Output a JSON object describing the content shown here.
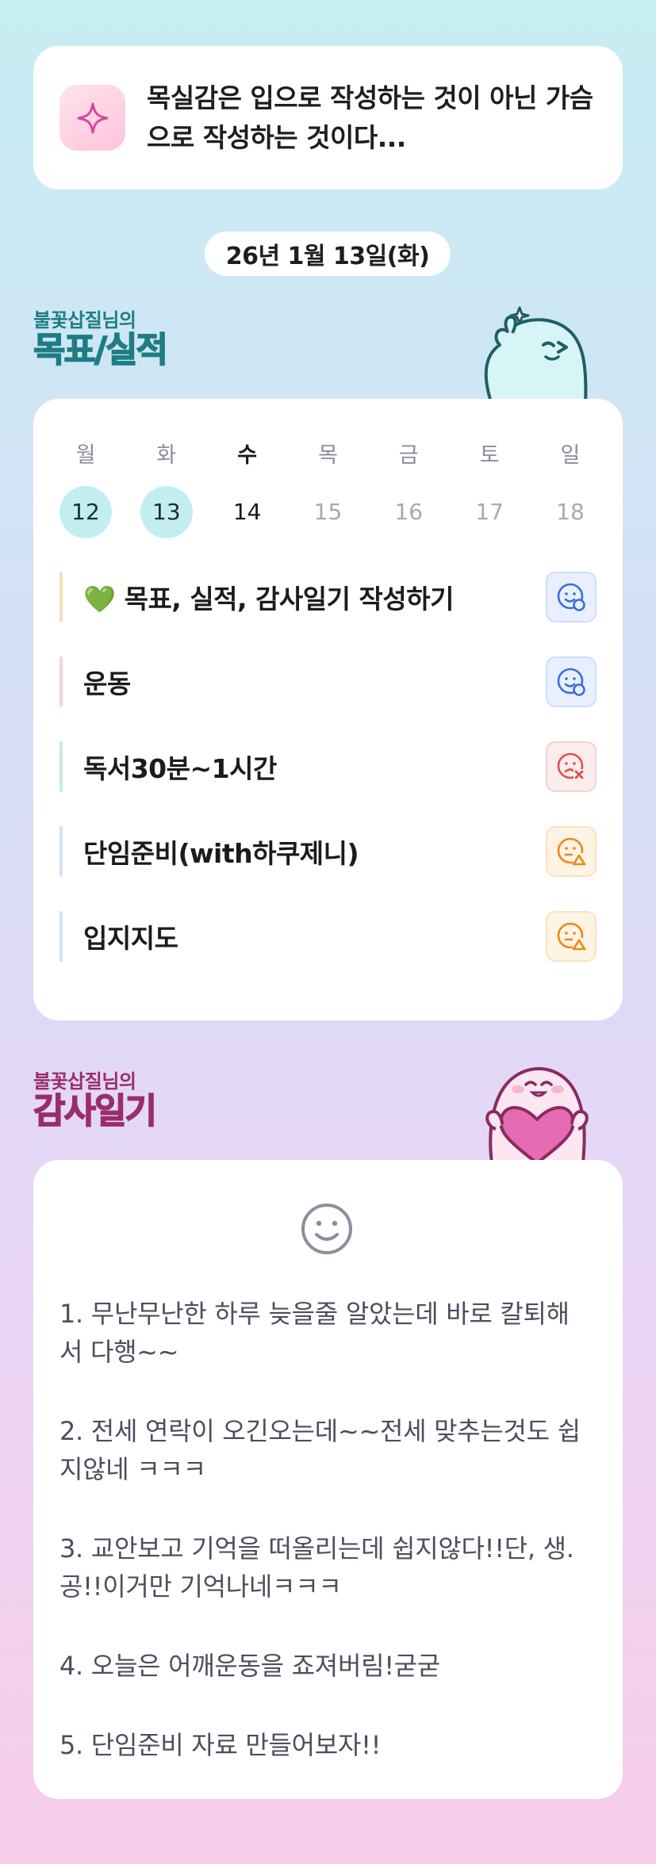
{
  "quote": {
    "icon": "sparkle-icon",
    "text": "목실감은 입으로 작성하는 것이 아닌 가슴으로 작성하는 것이다..."
  },
  "date": "26년 1월 13일(화)",
  "goals": {
    "owner": "불꽃삽질님의",
    "title": "목표/실적",
    "week": [
      {
        "dow": "월",
        "date": "12",
        "state": "done"
      },
      {
        "dow": "화",
        "date": "13",
        "state": "done"
      },
      {
        "dow": "수",
        "date": "14",
        "state": "today"
      },
      {
        "dow": "목",
        "date": "15",
        "state": "future"
      },
      {
        "dow": "금",
        "date": "16",
        "state": "future"
      },
      {
        "dow": "토",
        "date": "17",
        "state": "future"
      },
      {
        "dow": "일",
        "date": "18",
        "state": "future"
      }
    ],
    "tasks": [
      {
        "label": "💚 목표, 실적, 감사일기 작성하기",
        "bar_color": "#f9dfbd",
        "status": "good",
        "status_icon": "smile-check-icon"
      },
      {
        "label": "운동",
        "bar_color": "#f8cfe3",
        "status": "good",
        "status_icon": "smile-check-icon"
      },
      {
        "label": "독서30분~1시간",
        "bar_color": "#c4ece2",
        "status": "bad",
        "status_icon": "sad-x-icon"
      },
      {
        "label": "단임준비(with하쿠제니)",
        "bar_color": "#d4e1fa",
        "status": "warn",
        "status_icon": "neutral-triangle-icon"
      },
      {
        "label": "입지지도",
        "bar_color": "#d4e1fa",
        "status": "warn",
        "status_icon": "neutral-triangle-icon"
      }
    ]
  },
  "gratitude": {
    "owner": "불꽃삽질님의",
    "title": "감사일기",
    "mood_icon": "smiley-face-icon",
    "entries": [
      "1. 무난무난한 하루 늦을줄 알았는데 바로 칼퇴해서 다행~~",
      "2. 전세 연락이 오긴오는데~~전세 맞추는것도 쉽지않네 ㅋㅋㅋ",
      "3. 교안보고 기억을 떠올리는데 쉽지않다!!단, 생.공!!이거만 기억나네ㅋㅋㅋ",
      "4. 오늘은 어깨운동을 죠져버림!굳굳",
      "5. 단임준비 자료 만들어보자!!"
    ]
  },
  "colors": {
    "accent_teal": "#1e7d84",
    "accent_plum": "#9a2d6e",
    "status_good": "#3b6fd8",
    "status_bad": "#d9534f",
    "status_warn": "#e88a1a"
  }
}
